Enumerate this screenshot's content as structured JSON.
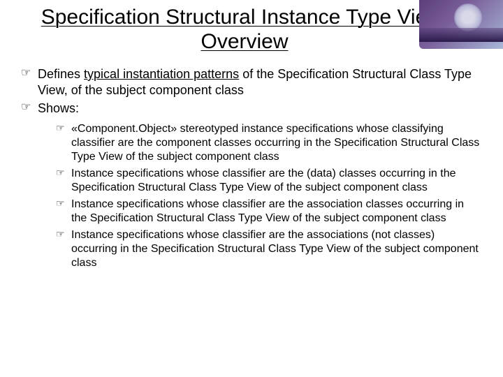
{
  "title": "Specification Structural Instance Type View: Overview",
  "bullet1_pre": "Defines ",
  "bullet1_underlined": "typical instantiation patterns",
  "bullet1_post": " of the Specification Structural Class Type View, of the subject component class",
  "bullet2": "Shows:",
  "sub1": "«Component.Object» stereotyped instance specifications whose classifying classifier are the component classes occurring in the Specification Structural Class Type View of the subject component class",
  "sub2": "Instance specifications whose classifier are the (data) classes occurring in the Specification Structural Class Type View of the subject component class",
  "sub3": "Instance specifications whose classifier are the association classes occurring in the Specification Structural Class Type View of the subject component class",
  "sub4": "Instance specifications whose classifier are the associations (not classes) occurring in the Specification Structural Class Type View of the subject component class"
}
